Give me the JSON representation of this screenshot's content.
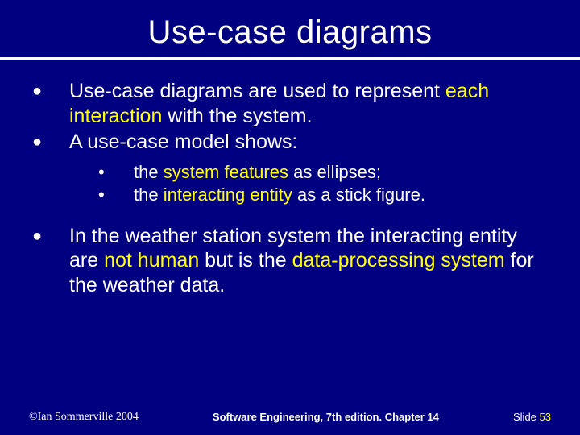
{
  "title": "Use-case diagrams",
  "bullets": {
    "b1": {
      "pre": "Use-case diagrams are used to represent ",
      "hi1": "each interaction",
      "post": " with the system."
    },
    "b2": "A use-case model shows:",
    "sub": {
      "s1": {
        "pre": "the ",
        "hi": "system features",
        "post": " as ellipses;"
      },
      "s2": {
        "pre": "the ",
        "hi": "interacting entity",
        "post": " as a stick figure."
      }
    },
    "b3": {
      "t1": "In the weather station system the interacting entity are ",
      "h1": "not human",
      "t2": " but is the ",
      "h2": "data-processing system",
      "t3": " for the weather data."
    }
  },
  "footer": {
    "copyright": "©Ian Sommerville 2004",
    "center": "Software Engineering, 7th edition. Chapter 14",
    "slide_label": "Slide ",
    "slide_number": "53"
  }
}
